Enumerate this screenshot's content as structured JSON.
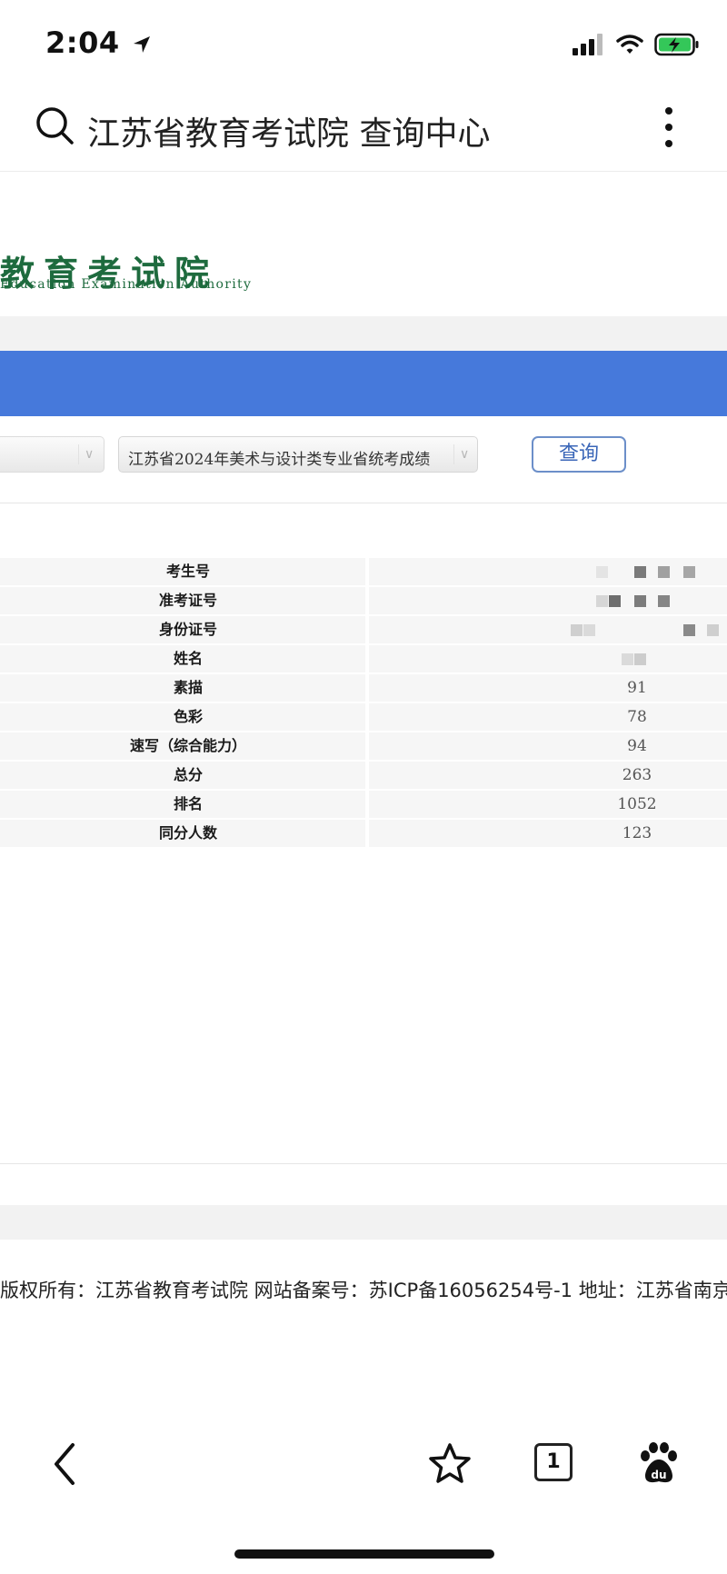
{
  "status_bar": {
    "time": "2:04"
  },
  "address_bar": {
    "title": "江苏省教育考试院 查询中心"
  },
  "logo": {
    "title": "教育考试院",
    "subtitle": "Education Examination Authority"
  },
  "query": {
    "exam_selected": "江苏省2024年美术与设计类专业省统考成绩",
    "button_label": "查询"
  },
  "results": {
    "rows": [
      {
        "label": "考生号",
        "value": ""
      },
      {
        "label": "准考证号",
        "value": ""
      },
      {
        "label": "身份证号",
        "value": ""
      },
      {
        "label": "姓名",
        "value": ""
      },
      {
        "label": "素描",
        "value": "91"
      },
      {
        "label": "色彩",
        "value": "78"
      },
      {
        "label": "速写（综合能力）",
        "value": "94"
      },
      {
        "label": "总分",
        "value": "263"
      },
      {
        "label": "排名",
        "value": "1052"
      },
      {
        "label": "同分人数",
        "value": "123"
      }
    ]
  },
  "footer": {
    "text": "版权所有：江苏省教育考试院 网站备案号：苏ICP备16056254号-1 地址：江苏省南京"
  },
  "toolbar": {
    "tab_count": "1"
  },
  "colors": {
    "accent_blue": "#4679db",
    "logo_green": "#1e6b3e",
    "button_blue": "#3a66b8"
  }
}
